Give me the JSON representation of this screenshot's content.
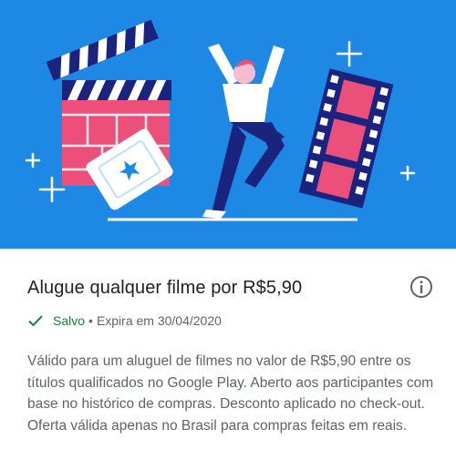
{
  "offer": {
    "title": "Alugue qualquer filme por R$5,90",
    "status_label": "Salvo",
    "separator": "•",
    "expiry_text": "Expira em 30/04/2020",
    "description": "Válido para um aluguel de filmes no valor de R$5,90 entre os títulos qualificados no Google Play. Aberto aos participantes com base no histórico de compras. Desconto aplicado no check-out. Oferta válida apenas no Brasil para compras feitas em reais."
  },
  "icons": {
    "info": "info-circle-icon",
    "status": "checkmark-icon"
  },
  "colors": {
    "hero_background": "#1e88e5",
    "illustration_pink": "#ec4f79",
    "illustration_navy": "#1a237e",
    "status_green": "#188038",
    "text_primary": "#202124",
    "text_secondary": "#5f6368"
  }
}
